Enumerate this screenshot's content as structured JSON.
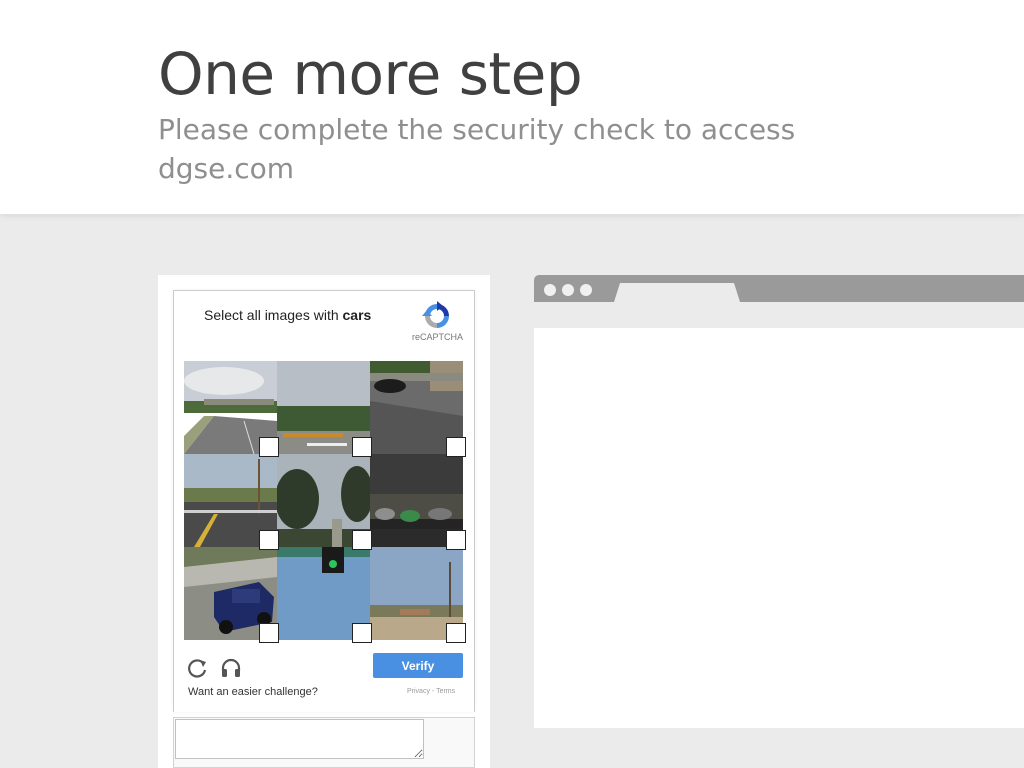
{
  "header": {
    "title": "One more step",
    "subtitle": "Please complete the security check to access dgse.com"
  },
  "captcha": {
    "prompt_prefix": "Select all images with",
    "prompt_target": "cars",
    "brand_label": "reCAPTCHA",
    "tiles": [
      {
        "id": 1,
        "selected": false
      },
      {
        "id": 2,
        "selected": false
      },
      {
        "id": 3,
        "selected": false
      },
      {
        "id": 4,
        "selected": false
      },
      {
        "id": 5,
        "selected": false
      },
      {
        "id": 6,
        "selected": false
      },
      {
        "id": 7,
        "selected": false
      },
      {
        "id": 8,
        "selected": false
      },
      {
        "id": 9,
        "selected": false
      }
    ],
    "reload_icon": "reload-icon",
    "audio_icon": "headphones-icon",
    "verify_label": "Verify",
    "easier_label": "Want an easier challenge?",
    "privacy_label": "Privacy",
    "separator": " - ",
    "terms_label": "Terms"
  },
  "response": {
    "value": ""
  },
  "colors": {
    "accent": "#4a90e2",
    "page_bg": "#ebebeb",
    "title": "#404040",
    "subtitle": "#8f8f8f"
  }
}
